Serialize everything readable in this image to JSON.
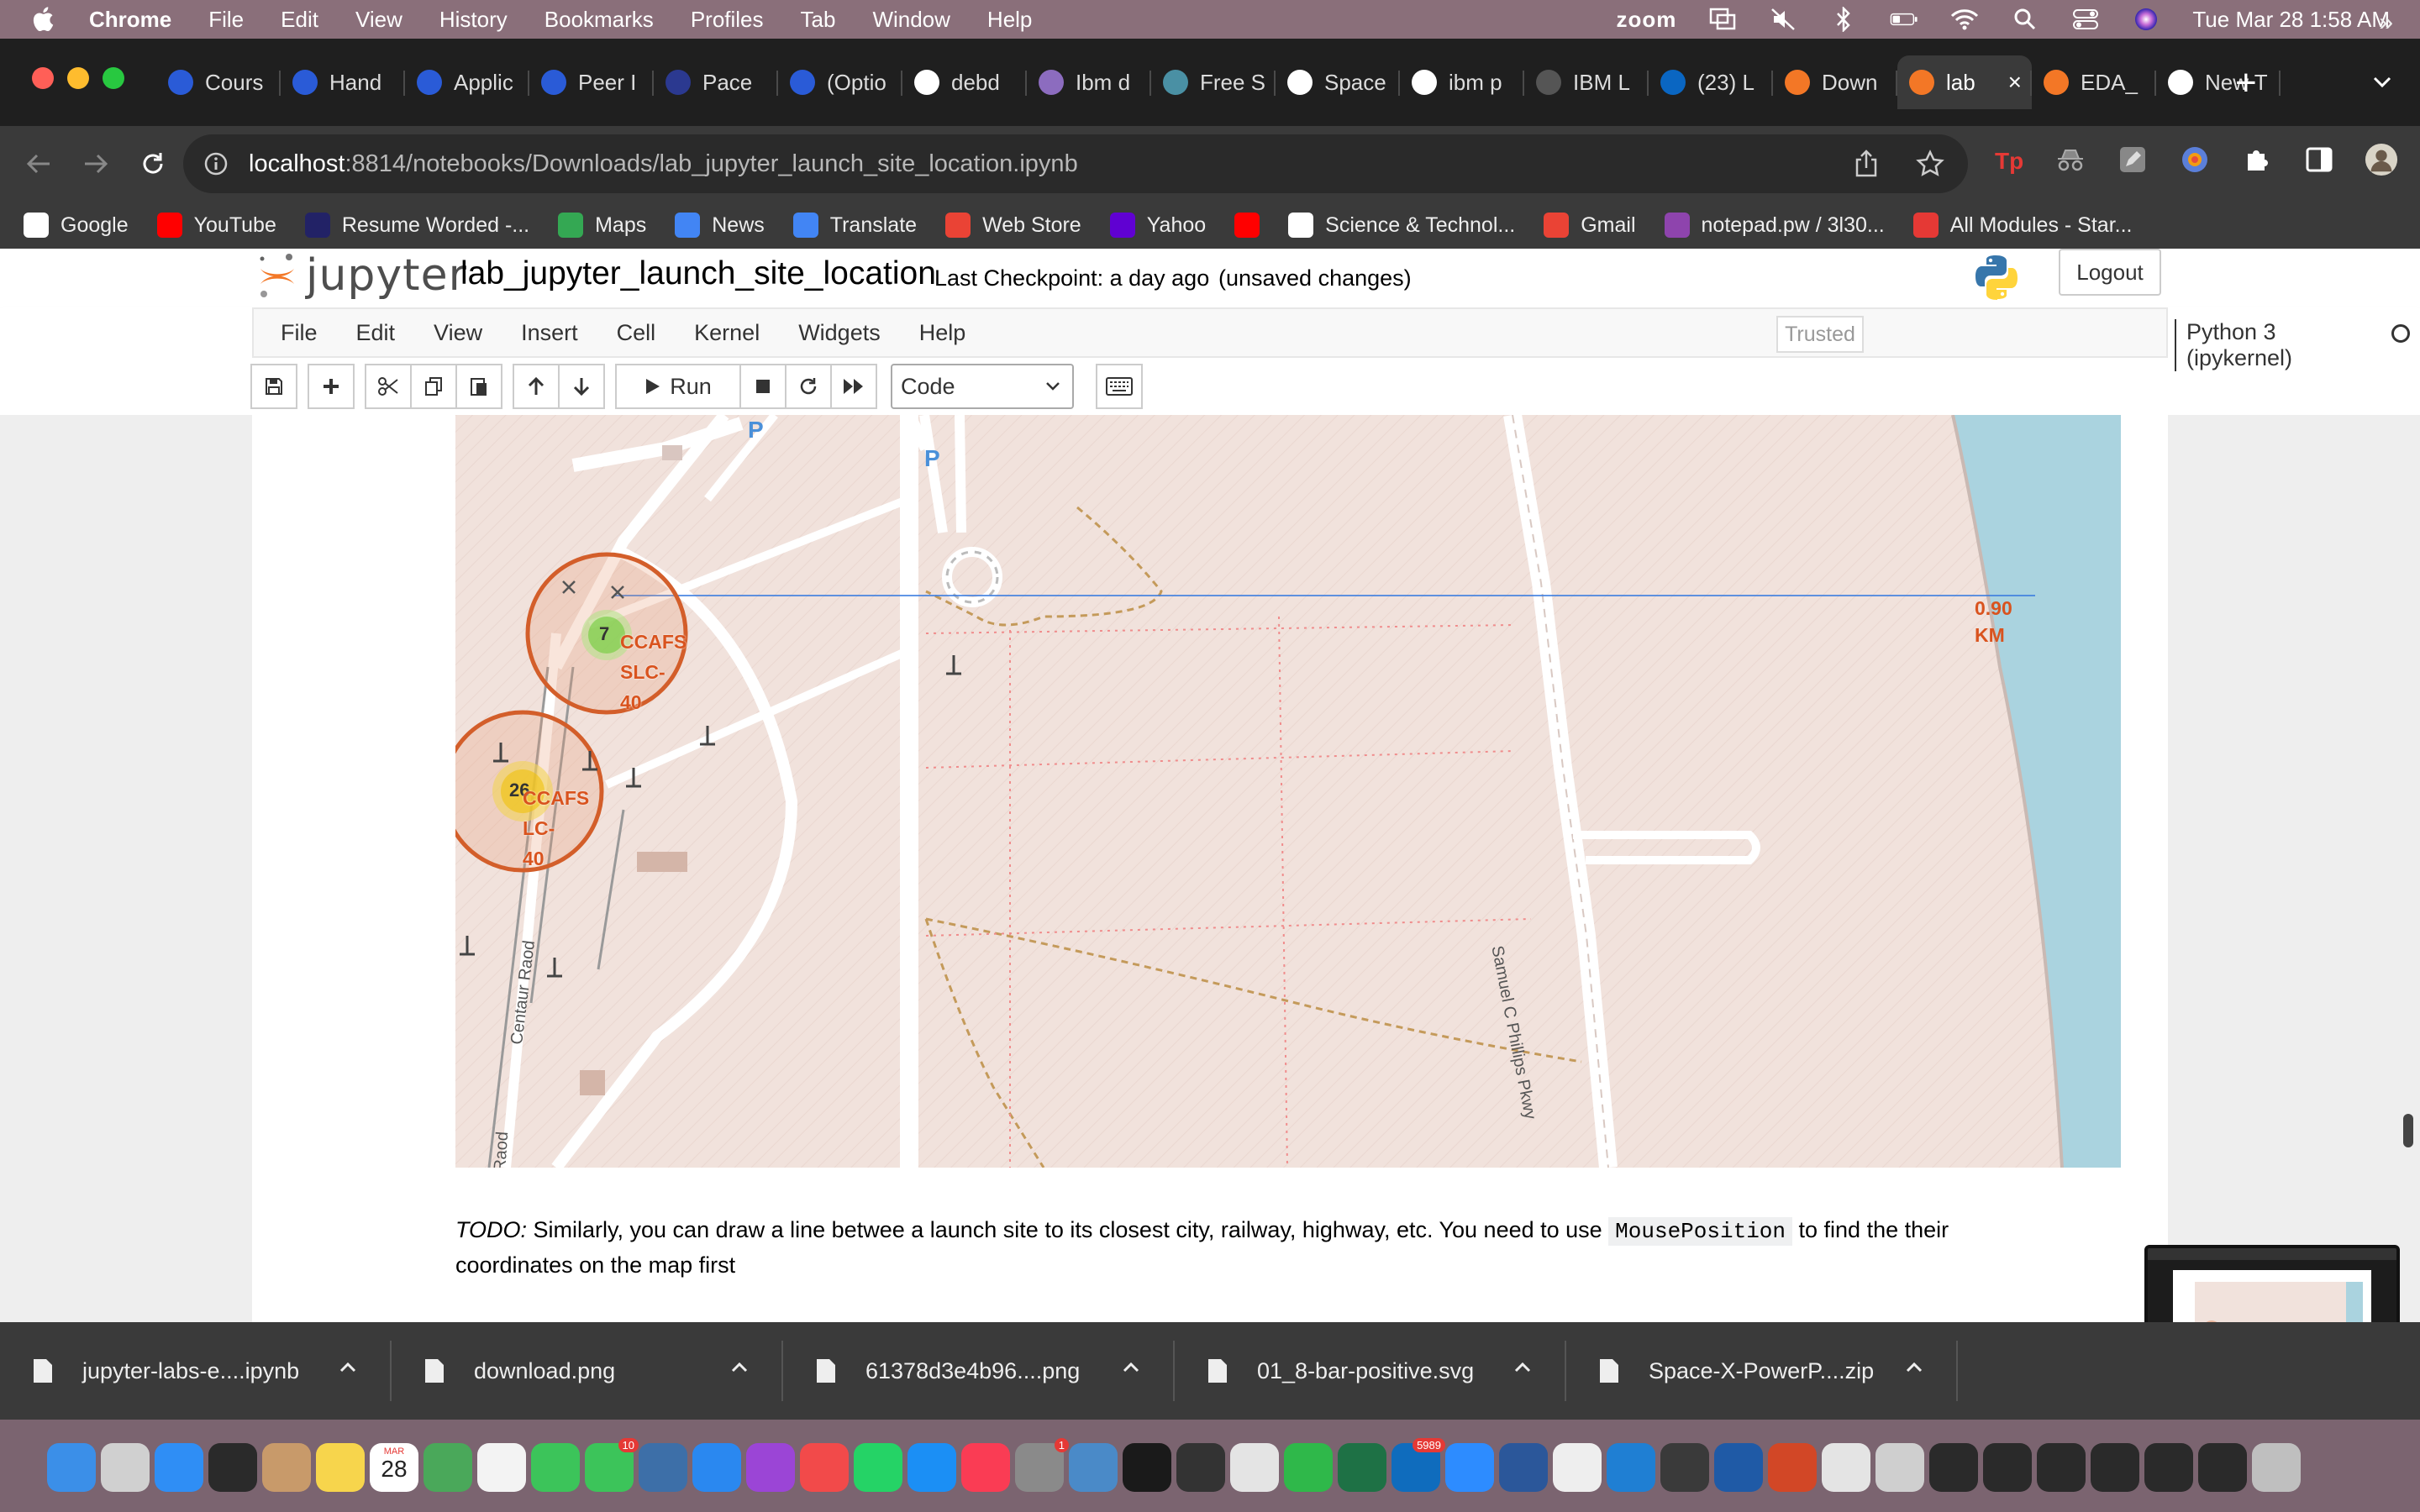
{
  "mac_menubar": {
    "app_name": "Chrome",
    "items": [
      "File",
      "Edit",
      "View",
      "History",
      "Bookmarks",
      "Profiles",
      "Tab",
      "Window",
      "Help"
    ],
    "zoom_label": "zoom",
    "datetime": "Tue Mar 28  1:58 AM"
  },
  "tabs": [
    {
      "label": "Cours",
      "icon": "coursera-icon",
      "color": "#2a5bd7"
    },
    {
      "label": "Hand",
      "icon": "coursera-icon",
      "color": "#2a5bd7"
    },
    {
      "label": "Applic",
      "icon": "coursera-icon",
      "color": "#2a5bd7"
    },
    {
      "label": "Peer I",
      "icon": "coursera-icon",
      "color": "#2a5bd7"
    },
    {
      "label": "Pace",
      "icon": "pace-icon",
      "color": "#2b3990"
    },
    {
      "label": "(Optio",
      "icon": "coursera-icon",
      "color": "#2a5bd7"
    },
    {
      "label": "debd",
      "icon": "github-icon",
      "color": "#ffffff"
    },
    {
      "label": "Ibm d",
      "icon": "ibm-icon",
      "color": "#8c6cbf"
    },
    {
      "label": "Free S",
      "icon": "vercel-icon",
      "color": "#4a90a4"
    },
    {
      "label": "Space",
      "icon": "github-icon",
      "color": "#ffffff"
    },
    {
      "label": "ibm p",
      "icon": "google-icon",
      "color": "#ffffff"
    },
    {
      "label": "IBM L",
      "icon": "ibm-icon",
      "color": "#555555"
    },
    {
      "label": "(23) L",
      "icon": "linkedin-icon",
      "color": "#0a66c2"
    },
    {
      "label": "Down",
      "icon": "jupyter-icon",
      "color": "#f37726"
    },
    {
      "label": "lab",
      "icon": "notebook-icon",
      "color": "#f37726",
      "active": true
    },
    {
      "label": "EDA_",
      "icon": "notebook-icon",
      "color": "#f37726"
    },
    {
      "label": "New T",
      "icon": "chrome-icon",
      "color": "#ffffff"
    }
  ],
  "address": {
    "host": "localhost",
    "path": ":8814/notebooks/Downloads/lab_jupyter_launch_site_location.ipynb"
  },
  "bookmarks": [
    {
      "label": "Google",
      "icon": "google-icon",
      "color": "#ffffff"
    },
    {
      "label": "YouTube",
      "icon": "youtube-icon",
      "color": "#ff0000"
    },
    {
      "label": "Resume Worded -...",
      "icon": "rw-icon",
      "color": "#222266"
    },
    {
      "label": "Maps",
      "icon": "maps-icon",
      "color": "#34a853"
    },
    {
      "label": "News",
      "icon": "news-icon",
      "color": "#4285f4"
    },
    {
      "label": "Translate",
      "icon": "translate-icon",
      "color": "#4285f4"
    },
    {
      "label": "Web Store",
      "icon": "webstore-icon",
      "color": "#ea4335"
    },
    {
      "label": "Yahoo",
      "icon": "yahoo-icon",
      "color": "#6001d2"
    },
    {
      "label": "",
      "icon": "youtube-icon",
      "color": "#ff0000"
    },
    {
      "label": "Science & Technol...",
      "icon": "science-icon",
      "color": "#ffffff"
    },
    {
      "label": "Gmail",
      "icon": "gmail-icon",
      "color": "#ea4335"
    },
    {
      "label": "notepad.pw / 3l30...",
      "icon": "notepad-icon",
      "color": "#8e44ad"
    },
    {
      "label": "All Modules - Star...",
      "icon": "star-icon",
      "color": "#e53935"
    }
  ],
  "jupyter": {
    "logo_text": "jupyter",
    "notebook_name": "lab_jupyter_launch_site_location",
    "checkpoint": "Last Checkpoint: a day ago",
    "unsaved": "(unsaved changes)",
    "logout": "Logout",
    "menu": [
      "File",
      "Edit",
      "View",
      "Insert",
      "Cell",
      "Kernel",
      "Widgets",
      "Help"
    ],
    "trusted": "Trusted",
    "kernel": "Python 3 (ipykernel)",
    "run_label": "Run",
    "cell_type": "Code"
  },
  "map": {
    "clusters": [
      {
        "count": "7",
        "site": [
          "CCAFS",
          "SLC-",
          "40"
        ]
      },
      {
        "count": "26",
        "site": [
          "CCAFS",
          "LC-",
          "40"
        ]
      }
    ],
    "distance": [
      "0.90",
      "KM"
    ],
    "roads": [
      "Samuel C Phillips Pkwy",
      "Centaur Raod",
      "Raod"
    ],
    "parking": "P",
    "coast_color": "#aad3df",
    "land_color": "#f1e2dc"
  },
  "markdown": {
    "todo_label": "TODO:",
    "text_before": " Similarly, you can draw a line betwee a launch site to its closest city, railway, highway, etc. You need to use ",
    "code": "MousePosition",
    "text_after": " to find the their coordinates on the map first"
  },
  "downloads": [
    "jupyter-labs-e....ipynb",
    "download.png",
    "61378d3e4b96....png",
    "01_8-bar-positive.svg",
    "Space-X-PowerP....zip"
  ],
  "dock": {
    "calendar_day": "28",
    "calendar_month": "MAR",
    "messages_badge": "10",
    "settings_badge": "1",
    "outlook_badge": "5989"
  }
}
